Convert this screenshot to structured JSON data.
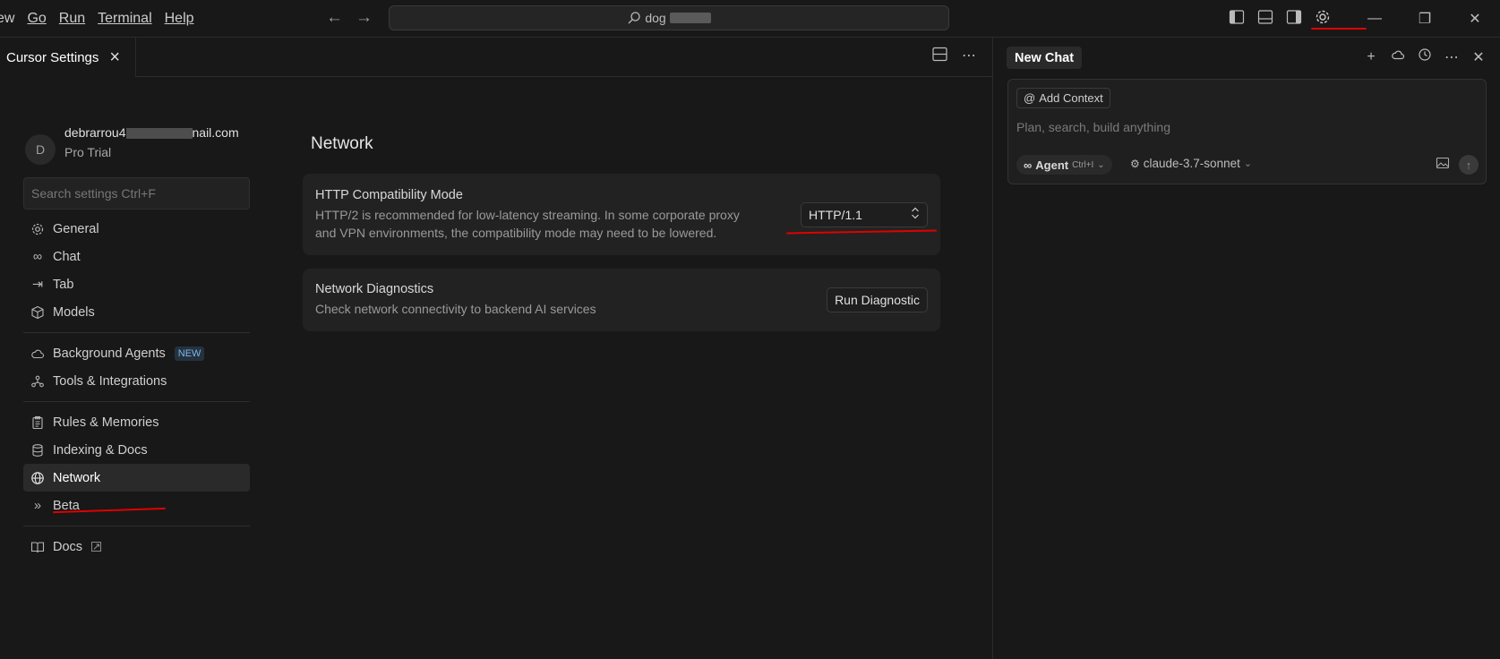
{
  "titlebar": {
    "menu": [
      "ew",
      "Go",
      "Run",
      "Terminal",
      "Help"
    ],
    "command_center_text": "dog",
    "window_controls": [
      "minimize",
      "restore",
      "close"
    ]
  },
  "editor": {
    "tab_label": "Cursor Settings"
  },
  "account": {
    "avatar_initial": "D",
    "email_prefix": "debrarrou4",
    "email_suffix": "nail.com",
    "plan": "Pro Trial"
  },
  "sidebar": {
    "search_placeholder": "Search settings Ctrl+F",
    "groups": [
      [
        {
          "label": "General",
          "icon": "gear-icon"
        },
        {
          "label": "Chat",
          "icon": "infinity-icon"
        },
        {
          "label": "Tab",
          "icon": "arrow-tab-icon"
        },
        {
          "label": "Models",
          "icon": "cube-icon"
        }
      ],
      [
        {
          "label": "Background Agents",
          "icon": "cloud-icon",
          "badge": "NEW"
        },
        {
          "label": "Tools & Integrations",
          "icon": "nodes-icon"
        }
      ],
      [
        {
          "label": "Rules & Memories",
          "icon": "clipboard-icon"
        },
        {
          "label": "Indexing & Docs",
          "icon": "database-icon"
        },
        {
          "label": "Network",
          "icon": "globe-icon",
          "active": true
        },
        {
          "label": "Beta",
          "icon": "double-chevron-icon"
        }
      ],
      [
        {
          "label": "Docs",
          "icon": "book-icon"
        }
      ]
    ]
  },
  "network": {
    "title": "Network",
    "http_mode": {
      "title": "HTTP Compatibility Mode",
      "desc_line1": "HTTP/2 is recommended for low-latency streaming. In some corporate proxy",
      "desc_line2": "and VPN environments, the compatibility mode may need to be lowered.",
      "value": "HTTP/1.1"
    },
    "diagnostics": {
      "title": "Network Diagnostics",
      "desc": "Check network connectivity to backend AI services",
      "button": "Run Diagnostic"
    }
  },
  "chat": {
    "tab_label": "New Chat",
    "add_context": "Add Context",
    "placeholder": "Plan, search, build anything",
    "agent_label": "Agent",
    "agent_shortcut": "Ctrl+I",
    "model": "claude-3.7-sonnet"
  },
  "colors": {
    "background": "#181818",
    "card": "#222222",
    "annotation": "#e00000"
  }
}
